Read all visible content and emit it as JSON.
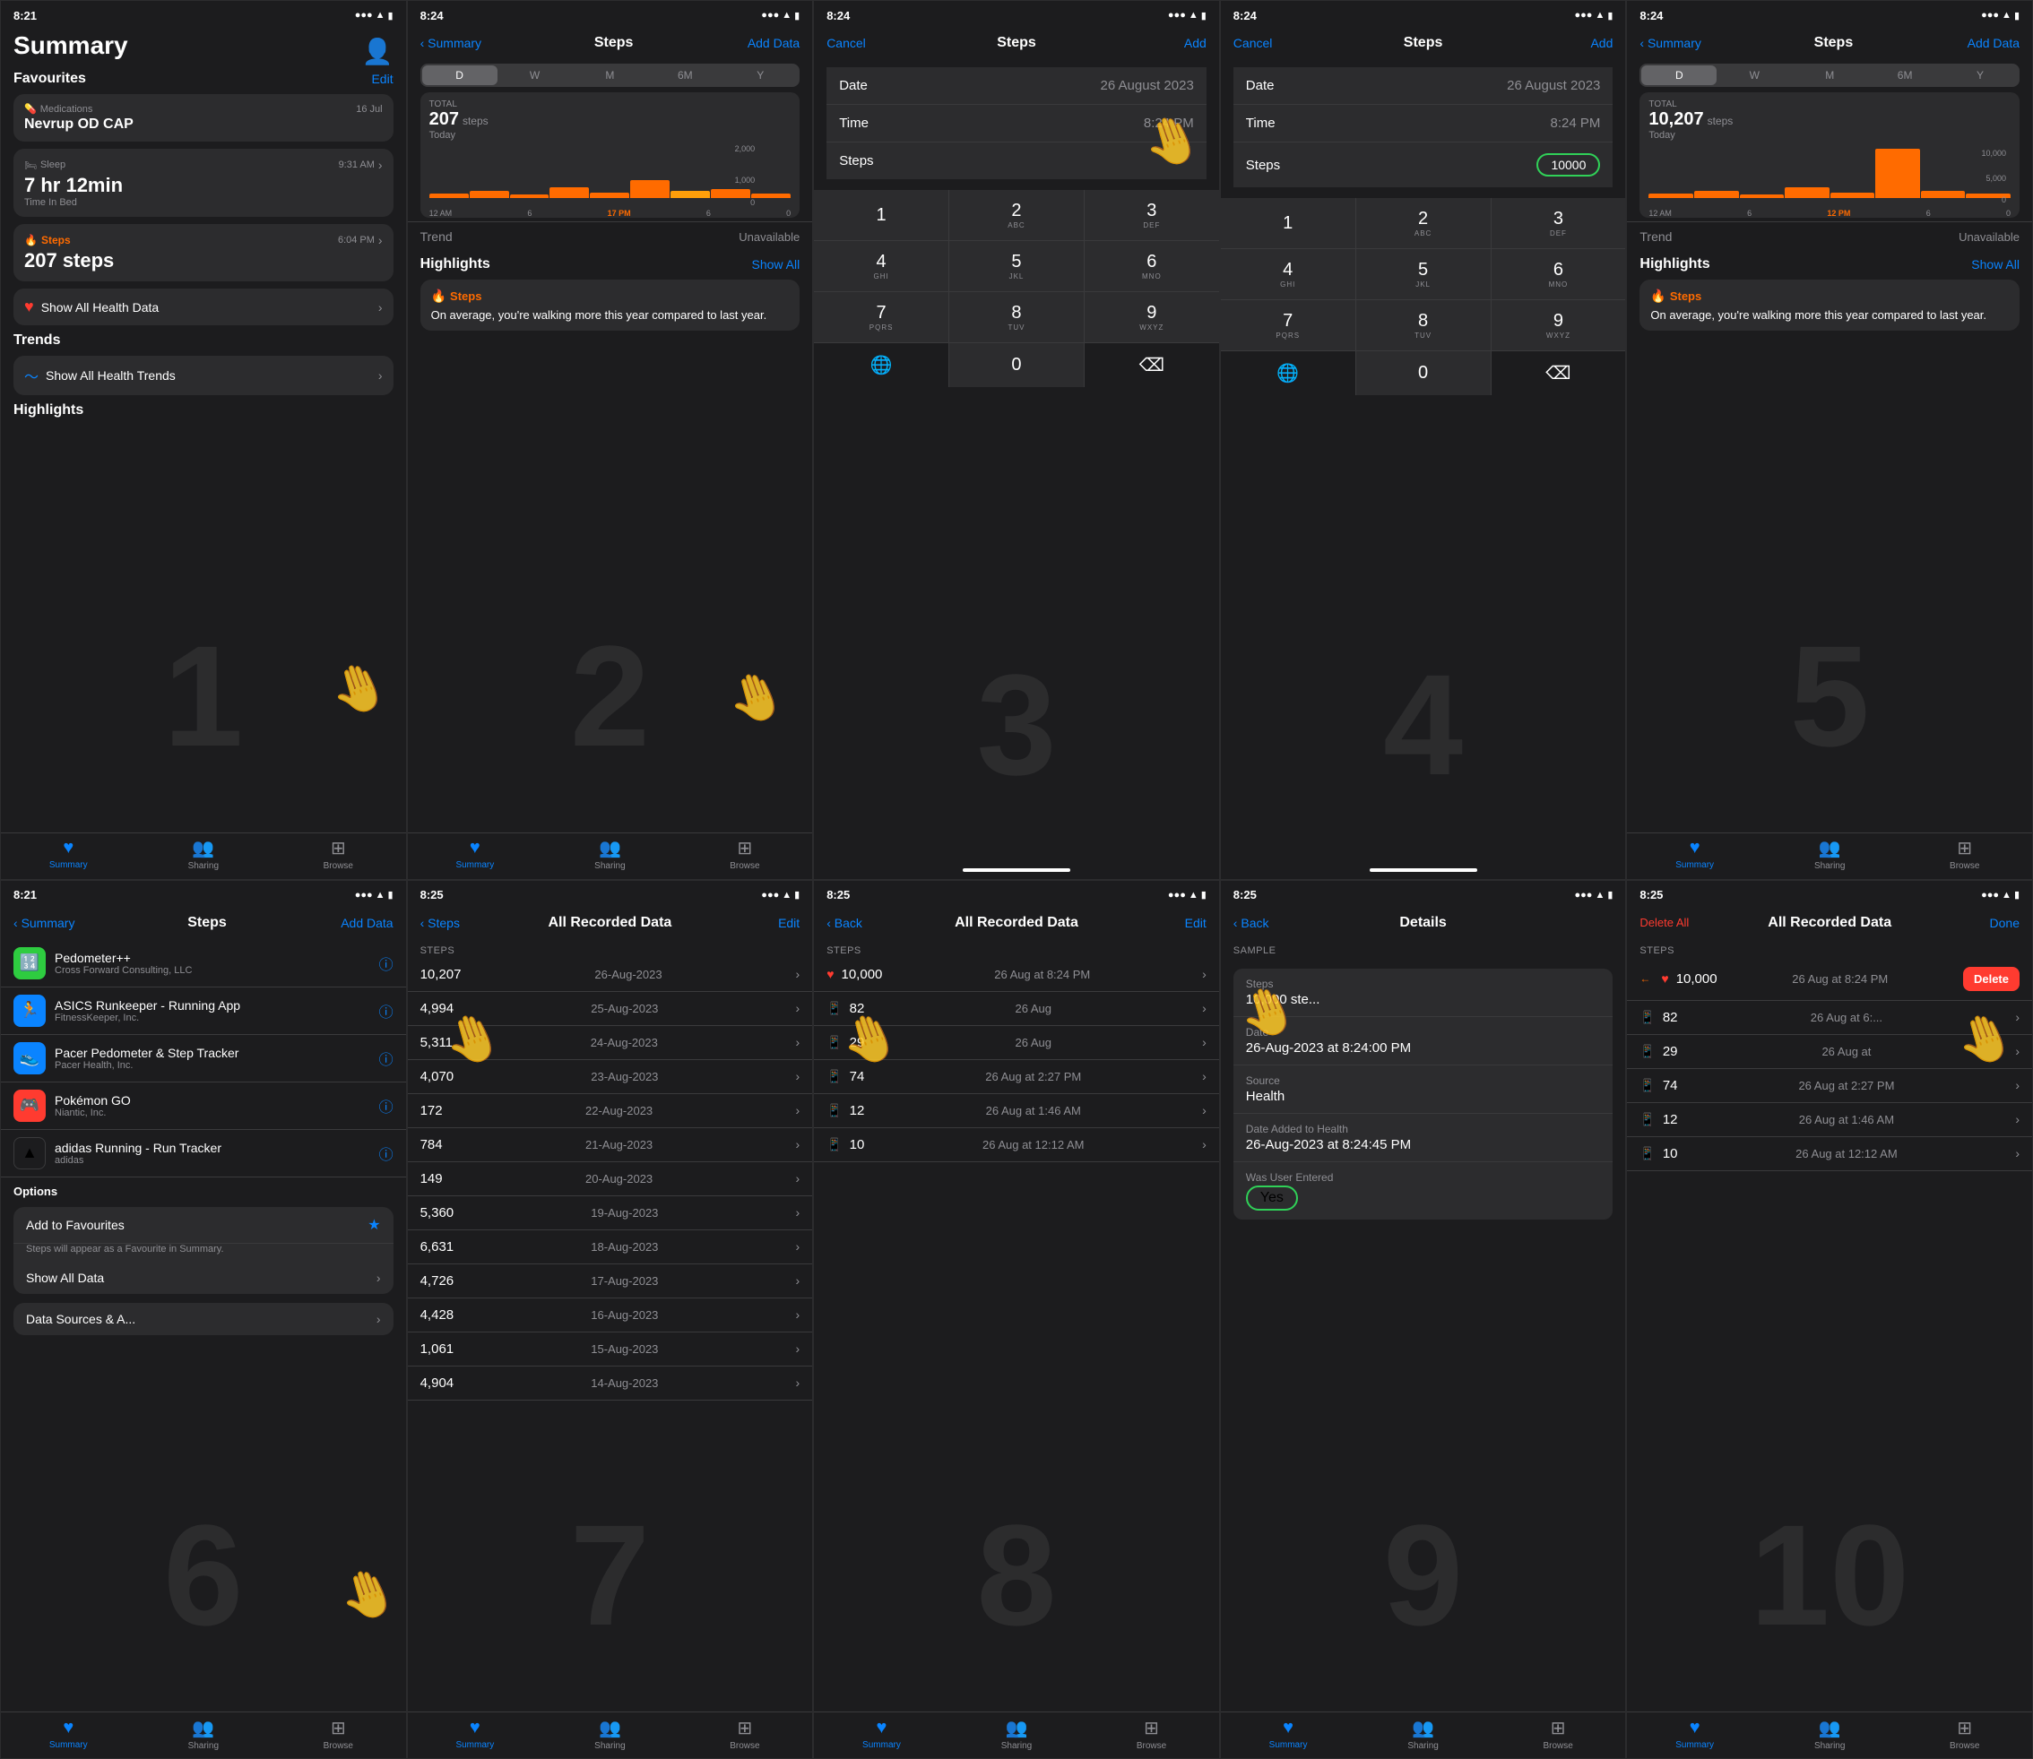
{
  "screens": [
    {
      "id": "screen1",
      "status_time": "8:21",
      "nav_back": "",
      "nav_title": "",
      "nav_right": "",
      "type": "summary_main"
    },
    {
      "id": "screen2",
      "status_time": "8:24",
      "nav_back": "Summary",
      "nav_title": "Steps",
      "nav_right": "Add Data",
      "type": "steps_chart"
    },
    {
      "id": "screen3",
      "status_time": "8:24",
      "nav_back": "Cancel",
      "nav_title": "Steps",
      "nav_right": "Add",
      "type": "add_steps_1"
    },
    {
      "id": "screen4",
      "status_time": "8:24",
      "nav_back": "Cancel",
      "nav_title": "Steps",
      "nav_right": "Add",
      "type": "add_steps_2"
    },
    {
      "id": "screen5",
      "status_time": "8:24",
      "nav_back": "Summary",
      "nav_title": "Steps",
      "nav_right": "Add Data",
      "type": "steps_chart_after"
    },
    {
      "id": "screen6",
      "status_time": "8:21",
      "nav_back": "Summary",
      "nav_title": "Steps",
      "nav_right": "Add Data",
      "type": "steps_sources"
    },
    {
      "id": "screen7",
      "status_time": "8:25",
      "nav_back": "Steps",
      "nav_title": "All Recorded Data",
      "nav_right": "Edit",
      "type": "all_data"
    },
    {
      "id": "screen8",
      "status_time": "8:25",
      "nav_back": "Back",
      "nav_title": "All Recorded Data",
      "nav_right": "Edit",
      "type": "all_data_2"
    },
    {
      "id": "screen9",
      "status_time": "8:25",
      "nav_back": "Back",
      "nav_title": "Details",
      "nav_right": "",
      "type": "details"
    },
    {
      "id": "screen10",
      "status_time": "8:25",
      "nav_back": "Delete All",
      "nav_title": "All Recorded Data",
      "nav_right": "Done",
      "type": "all_data_delete"
    }
  ],
  "screen1": {
    "title": "Summary",
    "avatar": "👤",
    "favourites_label": "Favourites",
    "edit_label": "Edit",
    "medications_label": "Medications",
    "medications_date": "16 Jul",
    "med_name": "Nevrup OD CAP",
    "sleep_label": "Sleep",
    "sleep_time": "9:31 AM",
    "sleep_value": "7 hr 12min",
    "sleep_sub": "Time In Bed",
    "steps_label": "Steps",
    "steps_time": "6:04 PM",
    "steps_value": "207 steps",
    "show_all_health": "Show All Health Data",
    "trends_title": "Trends",
    "show_all_trends": "Show All Health Trends",
    "highlights_title": "Highlights",
    "tabs": [
      "Summary",
      "Sharing",
      "Browse"
    ]
  },
  "screen2": {
    "seg_options": [
      "D",
      "W",
      "M",
      "6M",
      "Y"
    ],
    "active_seg": 0,
    "total_label": "TOTAL",
    "steps_value": "207",
    "steps_unit": "steps",
    "date_label": "Today",
    "trend_label": "Trend",
    "trend_value": "Unavailable",
    "highlights_title": "Highlights",
    "show_all": "Show All",
    "steps_highlight": "Steps",
    "highlight_text": "On average, you're walking more this year compared to last year.",
    "tabs": [
      "Summary",
      "Sharing",
      "Browse"
    ]
  },
  "screen3": {
    "date_label": "Date",
    "date_value": "26 August 2023",
    "time_label": "Time",
    "time_value": "8:24 PM",
    "steps_label": "Steps",
    "steps_value": "",
    "keys": [
      {
        "main": "1",
        "sub": ""
      },
      {
        "main": "2",
        "sub": "ABC"
      },
      {
        "main": "3",
        "sub": "DEF"
      },
      {
        "main": "4",
        "sub": "GHI"
      },
      {
        "main": "5",
        "sub": "JKL"
      },
      {
        "main": "6",
        "sub": "MNO"
      },
      {
        "main": "7",
        "sub": "PQRS"
      },
      {
        "main": "8",
        "sub": "TUV"
      },
      {
        "main": "9",
        "sub": "WXYZ"
      },
      {
        "main": "0",
        "sub": ""
      },
      {
        "main": "⌫",
        "sub": ""
      }
    ],
    "globe_icon": "🌐"
  },
  "screen4": {
    "date_label": "Date",
    "date_value": "26 August 2023",
    "time_label": "Time",
    "time_value": "8:24 PM",
    "steps_label": "Steps",
    "steps_value": "10000",
    "oval_highlight": true
  },
  "screen5": {
    "seg_options": [
      "D",
      "W",
      "M",
      "6M",
      "Y"
    ],
    "active_seg": 0,
    "total_label": "TOTAL",
    "steps_value": "10,207",
    "steps_unit": "steps",
    "date_label": "Today",
    "trend_label": "Trend",
    "trend_value": "Unavailable",
    "highlights_title": "Highlights",
    "show_all": "Show All",
    "steps_highlight": "Steps",
    "highlight_text": "On average, you're walking more this year compared to last year.",
    "tabs": [
      "Summary",
      "Sharing",
      "Browse"
    ]
  },
  "screen6": {
    "apps": [
      {
        "name": "Pedometer++",
        "dev": "Cross Forward Consulting, LLC",
        "icon": "🟢"
      },
      {
        "name": "ASICS Runkeeper - Running App",
        "dev": "FitnessKeeper, Inc.",
        "icon": "🔵"
      },
      {
        "name": "Pacer Pedometer & Step Tracker",
        "dev": "Pacer Health, Inc.",
        "icon": "🔵"
      },
      {
        "name": "Pokémon GO",
        "dev": "Niantic, Inc.",
        "icon": "🎮"
      },
      {
        "name": "adidas Running - Run Tracker",
        "dev": "adidas",
        "icon": "⚫"
      }
    ],
    "options_title": "Options",
    "add_to_fav": "Add to Favourites",
    "fav_sub": "Steps will appear as a Favourite in Summary.",
    "show_all_data": "Show All Data",
    "data_sources": "Data Sources & A...",
    "tabs": [
      "Summary",
      "Sharing",
      "Browse"
    ]
  },
  "screen7": {
    "section_header": "STEPS",
    "data_rows": [
      {
        "val": "10,207",
        "date": "26-Aug-2023"
      },
      {
        "val": "4,994",
        "date": "25-Aug-2023"
      },
      {
        "val": "5,311",
        "date": "24-Aug-2023"
      },
      {
        "val": "4,070",
        "date": "23-Aug-2023"
      },
      {
        "val": "172",
        "date": "22-Aug-2023"
      },
      {
        "val": "784",
        "date": "21-Aug-2023"
      },
      {
        "val": "149",
        "date": "20-Aug-2023"
      },
      {
        "val": "5,360",
        "date": "19-Aug-2023"
      },
      {
        "val": "6,631",
        "date": "18-Aug-2023"
      },
      {
        "val": "4,726",
        "date": "17-Aug-2023"
      },
      {
        "val": "4,428",
        "date": "16-Aug-2023"
      },
      {
        "val": "1,061",
        "date": "15-Aug-2023"
      },
      {
        "val": "4,904",
        "date": "14-Aug-2023"
      }
    ],
    "tabs": [
      "Summary",
      "Sharing",
      "Browse"
    ]
  },
  "screen8": {
    "section_header": "STEPS",
    "data_rows": [
      {
        "val": "10,000",
        "date": "26 Aug at 8:24 PM",
        "source": "heart"
      },
      {
        "val": "82",
        "date": "26 Aug",
        "source": "phone"
      },
      {
        "val": "29",
        "date": "26 Aug",
        "source": "phone"
      },
      {
        "val": "74",
        "date": "26 Aug at 2:27 PM",
        "source": "phone"
      },
      {
        "val": "12",
        "date": "26 Aug at 1:46 AM",
        "source": "phone"
      },
      {
        "val": "10",
        "date": "26 Aug at 12:12 AM",
        "source": "phone"
      }
    ],
    "tabs": [
      "Summary",
      "Sharing",
      "Browse"
    ]
  },
  "screen9": {
    "detail_title": "Details",
    "sample_label": "SAMPLE",
    "steps_label": "Steps",
    "steps_value": "10,000 ste...",
    "date_label": "Date",
    "date_value": "26-Aug-2023 at 8:24:00 PM",
    "source_label": "Source",
    "source_value": "Health",
    "date_added_label": "Date Added to Health",
    "date_added_value": "26-Aug-2023 at 8:24:45 PM",
    "was_user_label": "Was User Entered",
    "was_user_value": "Yes",
    "oval_highlight": true
  },
  "screen10": {
    "section_header": "STEPS",
    "data_rows": [
      {
        "val": "10,000",
        "date": "26 Aug at 8:24 PM",
        "source": "heart",
        "highlight": true
      },
      {
        "val": "82",
        "date": "26 Aug at 6:...",
        "source": "phone"
      },
      {
        "val": "29",
        "date": "26 Aug at",
        "source": "phone"
      },
      {
        "val": "74",
        "date": "26 Aug at 2:27 PM",
        "source": "phone"
      },
      {
        "val": "12",
        "date": "26 Aug at 1:46 AM",
        "source": "phone"
      },
      {
        "val": "10",
        "date": "26 Aug at 12:12 AM",
        "source": "phone"
      }
    ],
    "delete_label": "Delete",
    "tabs": [
      "Summary",
      "Sharing",
      "Browse"
    ]
  },
  "tab_icons": {
    "summary": "♥",
    "sharing": "👥",
    "browse": "⊞"
  },
  "colors": {
    "accent": "#0a84ff",
    "orange": "#ff6b00",
    "red": "#ff3b30",
    "green": "#30d158",
    "bg": "#1c1c1e",
    "card": "#2c2c2e",
    "separator": "#3a3a3c",
    "text_secondary": "#8e8e93"
  }
}
